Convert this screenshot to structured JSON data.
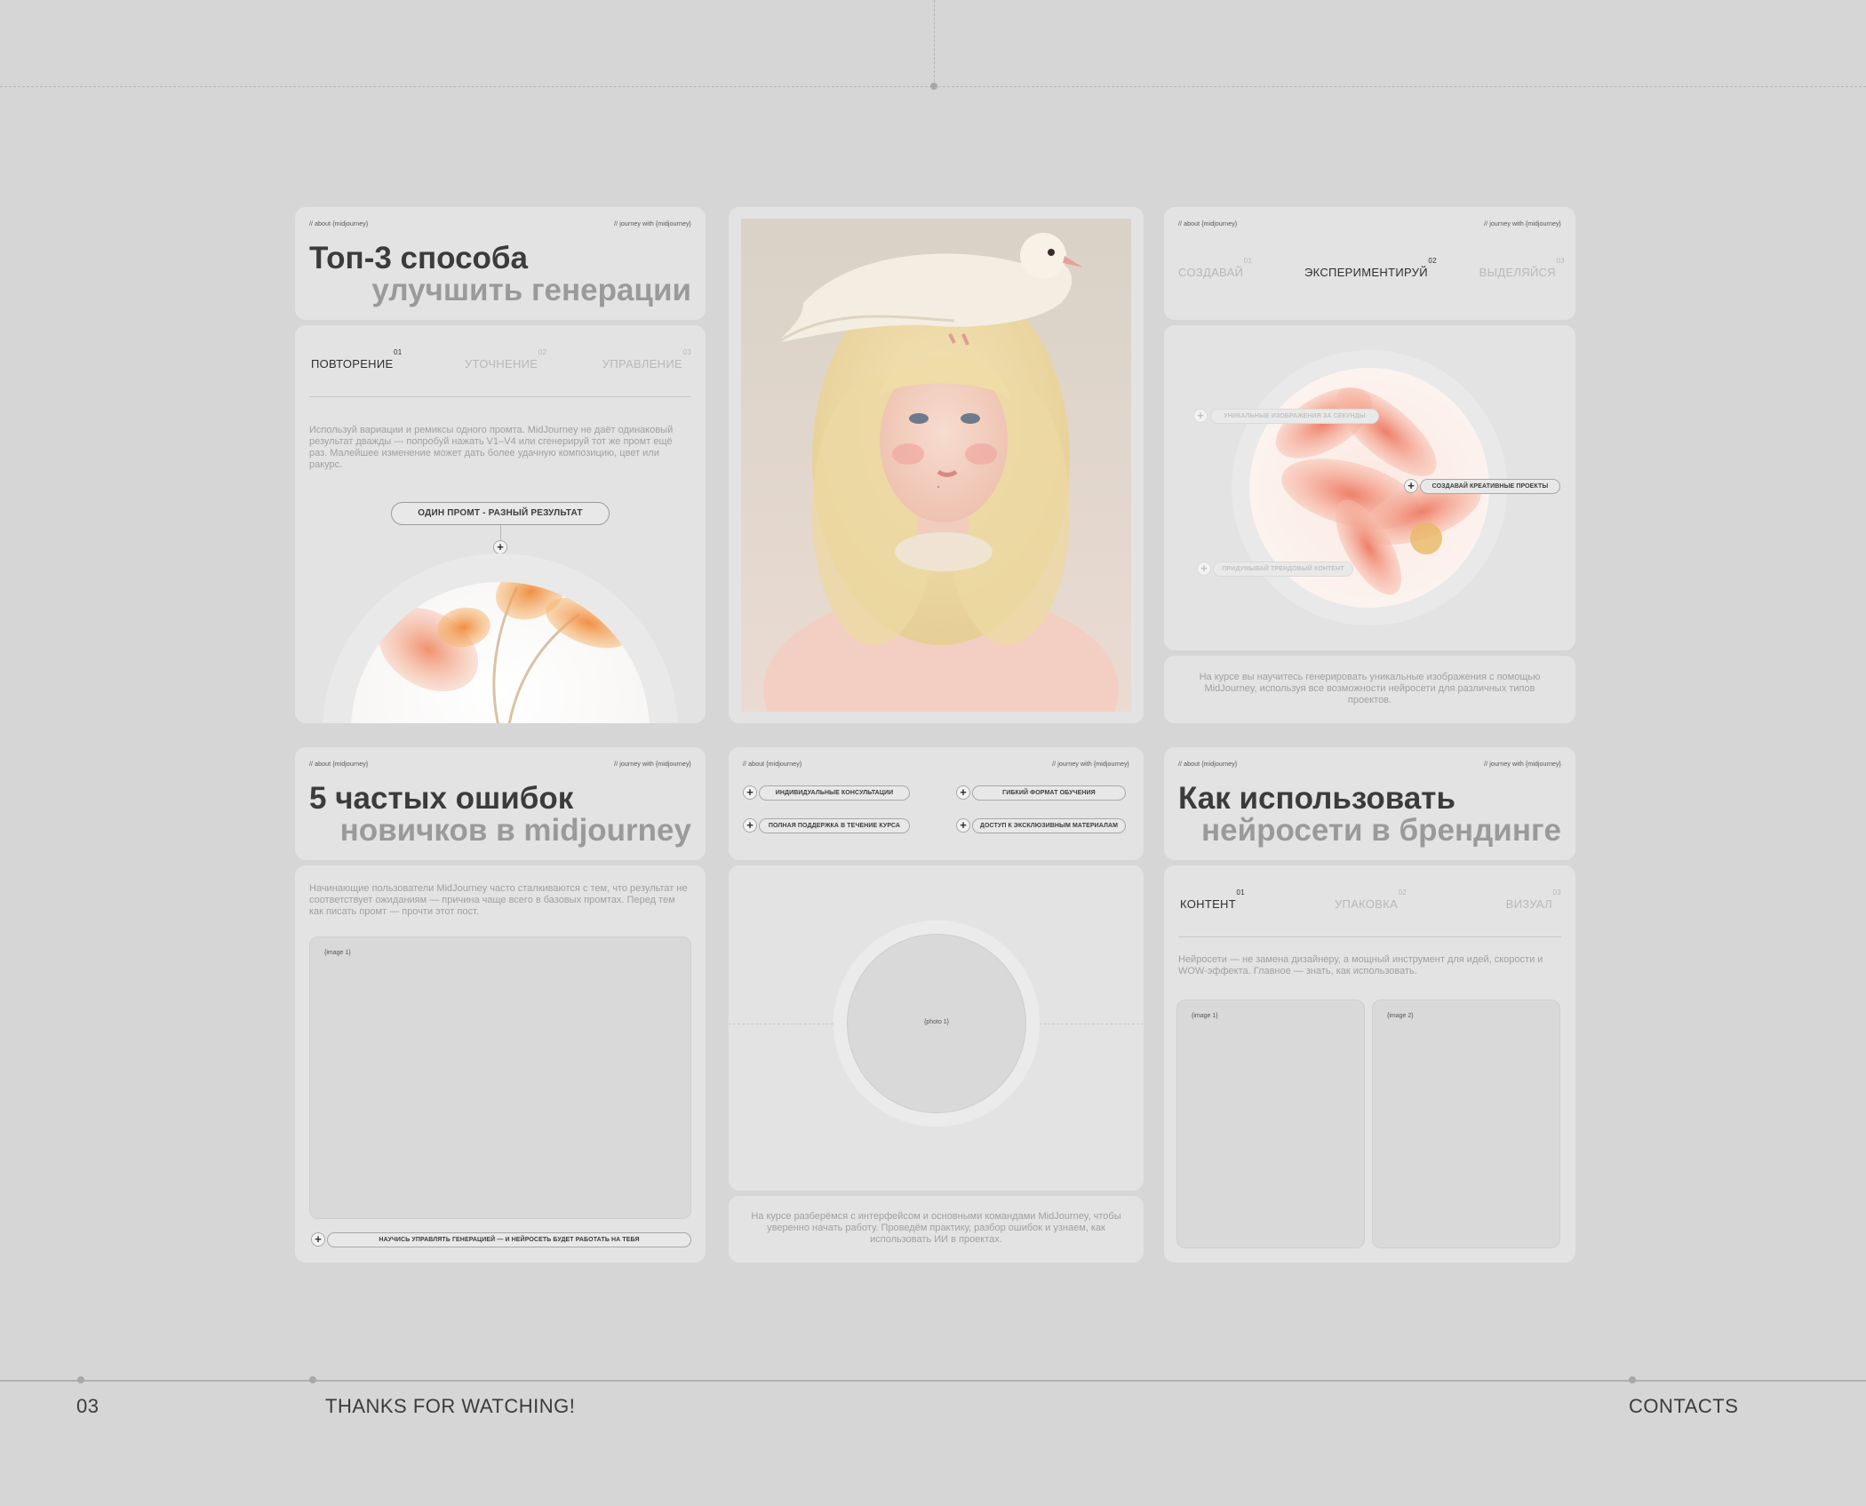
{
  "slide": {
    "page_number": "03",
    "footer_left": "THANKS FOR WATCHING!",
    "footer_right": "CONTACTS"
  },
  "tags": {
    "about": "// about {midjourney}",
    "journey": "// journey with {midjourney}"
  },
  "card_methods": {
    "title_line1": "Топ-3 способа",
    "title_line2": "улучшить генерации",
    "tabs": [
      {
        "label": "ПОВТОРЕНИЕ",
        "num": "01"
      },
      {
        "label": "УТОЧНЕНИЕ",
        "num": "02"
      },
      {
        "label": "УПРАВЛЕНИЕ",
        "num": "03"
      }
    ],
    "text": "Используй вариации и ремиксы одного промта. MidJourney не даёт одинаковый результат дважды — попробуй нажать V1–V4 или сгенерируй тот же промт ещё раз. Малейшее изменение может дать более удачную композицию, цвет или ракурс.",
    "pill": "ОДИН ПРОМТ - РАЗНЫЙ РЕЗУЛЬТАТ"
  },
  "card_experiment": {
    "tabs": [
      {
        "label": "СОЗДАВАЙ",
        "num": "01"
      },
      {
        "label": "ЭКСПЕРИМЕНТИРУЙ",
        "num": "02"
      },
      {
        "label": "ВЫДЕЛЯЙСЯ",
        "num": "03"
      }
    ],
    "chips": [
      "УНИКАЛЬНЫЕ ИЗОБРАЖЕНИЯ ЗА СЕКУНДЫ",
      "СОЗДАВАЙ КРЕАТИВНЫЕ ПРОЕКТЫ",
      "ПРИДУМЫВАЙ ТРЕНДОВЫЙ КОНТЕНТ"
    ],
    "text": "На курсе вы научитесь генерировать уникальные изображения с помощью MidJourney, используя все возможности нейросети для различных типов проектов."
  },
  "card_mistakes": {
    "title_line1": "5 частых ошибок",
    "title_line2": "новичков в midjourney",
    "text": "Начинающие пользователи MidJourney часто сталкиваются с тем, что результат не соответствует ожиданиям — причина чаще всего в базовых промтах. Перед тем как писать промт — прочти этот пост.",
    "image_label": "{image 1}",
    "bottom_chip": "НАУЧИСЬ УПРАВЛЯТЬ ГЕНЕРАЦИЕЙ — И НЕЙРОСЕТЬ БУДЕТ РАБОТАТЬ НА ТЕБЯ"
  },
  "card_course": {
    "chips": [
      "ИНДИВИДУАЛЬНЫЕ КОНСУЛЬТАЦИИ",
      "ГИБКИЙ ФОРМАТ ОБУЧЕНИЯ",
      "ПОЛНАЯ ПОДДЕРЖКА В ТЕЧЕНИЕ КУРСА",
      "ДОСТУП К ЭКСКЛЮЗИВНЫМ МАТЕРИАЛАМ"
    ],
    "photo_label": "{photo 1}",
    "text": "На курсе разберёмся с интерфейсом и основными командами MidJourney, чтобы уверенно начать работу. Проведём практику, разбор ошибок и узнаем, как использовать ИИ в проектах."
  },
  "card_branding": {
    "title_line1": "Как использовать",
    "title_line2": "нейросети в брендинге",
    "tabs": [
      {
        "label": "КОНТЕНТ",
        "num": "01"
      },
      {
        "label": "УПАКОВКА",
        "num": "02"
      },
      {
        "label": "ВИЗУАЛ",
        "num": "03"
      }
    ],
    "text": "Нейросети — не замена дизайнеру, а мощный инструмент для идей, скорости и WOW-эффекта. Главное — знать, как использовать.",
    "image1_label": "{image 1}",
    "image2_label": "{image 2}"
  },
  "colors": {
    "background": "#d6d6d6",
    "panel": "#e3e3e3",
    "text_dark": "#3b3b3b",
    "text_muted": "#9a9a9a",
    "flower_orange": "#f09a52",
    "flower_pink": "#f3a9a0"
  }
}
